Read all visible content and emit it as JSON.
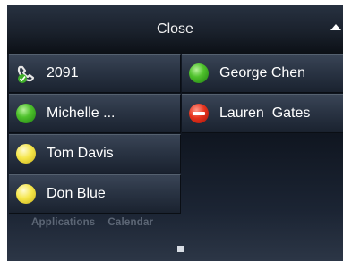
{
  "header": {
    "close_label": "Close"
  },
  "buddies": [
    {
      "name": "2091",
      "status": "phone"
    },
    {
      "name": "George Chen",
      "status": "available"
    },
    {
      "name": "Michelle ...",
      "status": "available"
    },
    {
      "name": "Lauren  Gates",
      "status": "do-not-disturb"
    },
    {
      "name": "Tom Davis",
      "status": "away"
    },
    {
      "name": "Don Blue",
      "status": "away"
    }
  ],
  "dock": {
    "applications": "Applications",
    "calendar": "Calendar"
  },
  "colors": {
    "available": "#4fc22c",
    "away": "#f5e64a",
    "do_not_disturb": "#e5321c"
  }
}
